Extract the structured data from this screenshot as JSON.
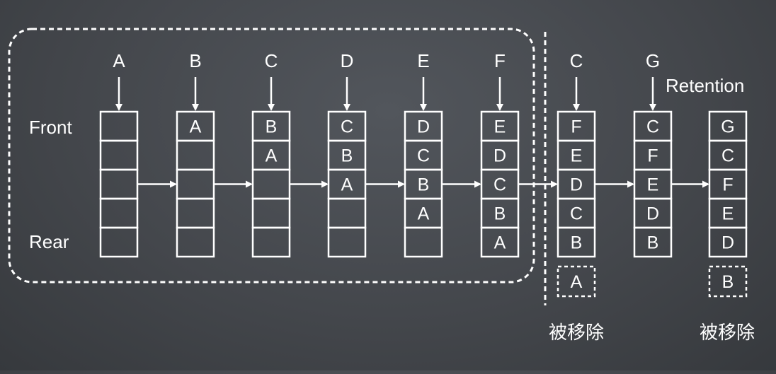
{
  "labels": {
    "front": "Front",
    "rear": "Rear",
    "retention": "Retention",
    "removed": "被移除"
  },
  "colors": {
    "background": "#45484d",
    "foreground": "#ffffff"
  },
  "queues": [
    {
      "input": "A",
      "cells": [
        "",
        "",
        "",
        "",
        ""
      ]
    },
    {
      "input": "B",
      "cells": [
        "A",
        "",
        "",
        "",
        ""
      ]
    },
    {
      "input": "C",
      "cells": [
        "B",
        "A",
        "",
        "",
        ""
      ]
    },
    {
      "input": "D",
      "cells": [
        "C",
        "B",
        "A",
        "",
        ""
      ]
    },
    {
      "input": "E",
      "cells": [
        "D",
        "C",
        "B",
        "A",
        ""
      ]
    },
    {
      "input": "F",
      "cells": [
        "E",
        "D",
        "C",
        "B",
        "A"
      ]
    },
    {
      "input": "C",
      "cells": [
        "F",
        "E",
        "D",
        "C",
        "B"
      ],
      "evicted": "A"
    },
    {
      "input": "G",
      "cells": [
        "C",
        "F",
        "E",
        "D",
        "B"
      ]
    },
    {
      "input": null,
      "cells": [
        "G",
        "C",
        "F",
        "E",
        "D"
      ],
      "evicted": "B"
    }
  ]
}
